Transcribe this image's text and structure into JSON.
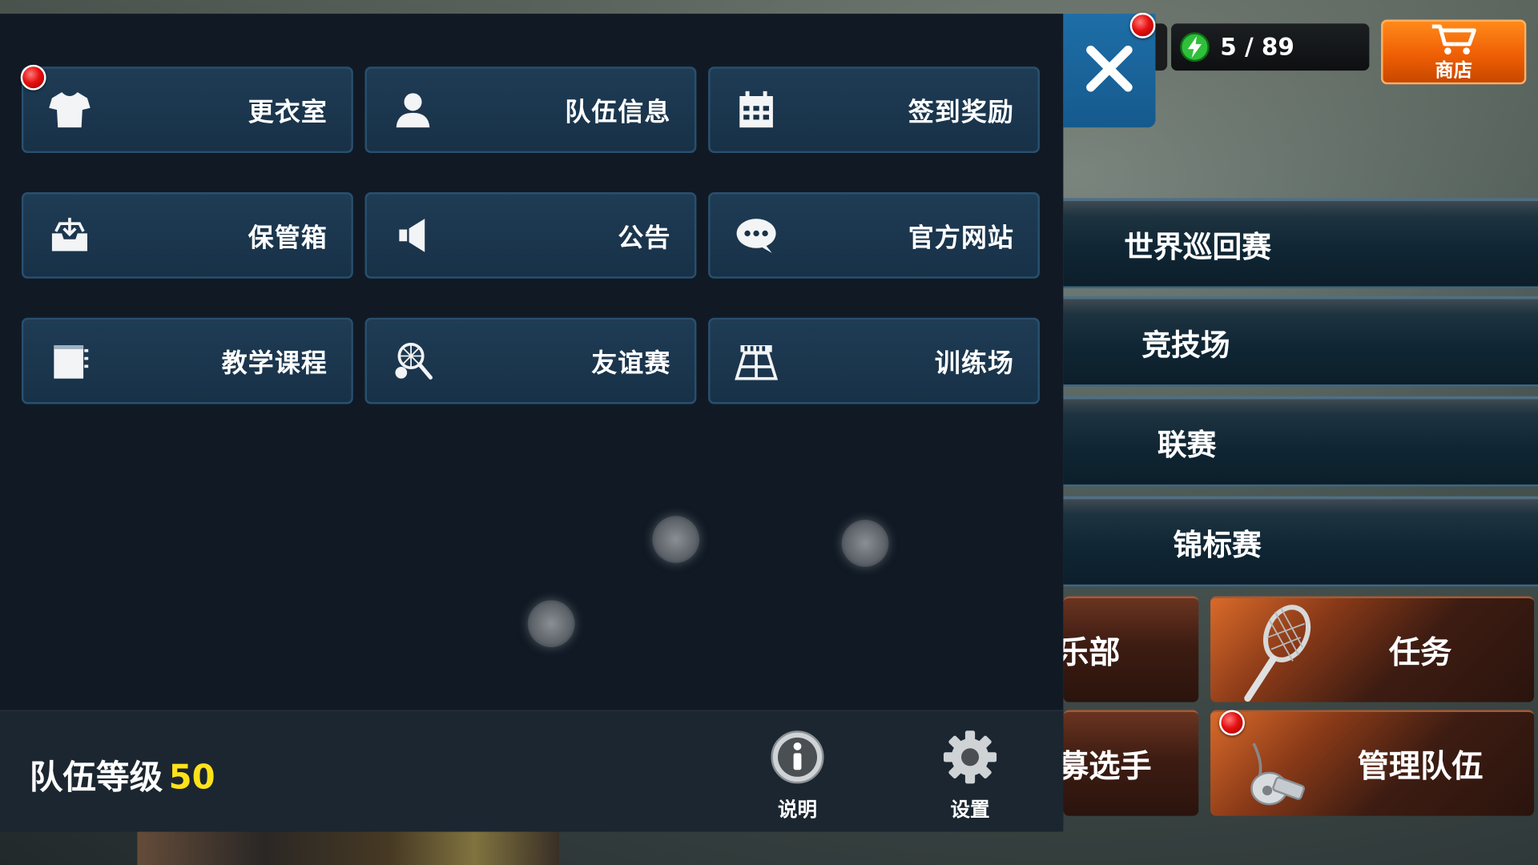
{
  "menu": {
    "items": [
      {
        "label": "更衣室",
        "icon": "shirt-icon",
        "badge": true
      },
      {
        "label": "队伍信息",
        "icon": "person-icon",
        "badge": false
      },
      {
        "label": "签到奖励",
        "icon": "calendar-icon",
        "badge": false
      },
      {
        "label": "保管箱",
        "icon": "inbox-icon",
        "badge": false
      },
      {
        "label": "公告",
        "icon": "megaphone-icon",
        "badge": false
      },
      {
        "label": "官方网站",
        "icon": "chat-bubble-icon",
        "badge": false
      },
      {
        "label": "教学课程",
        "icon": "notebook-icon",
        "badge": false
      },
      {
        "label": "友谊赛",
        "icon": "racket-ball-icon",
        "badge": false
      },
      {
        "label": "训练场",
        "icon": "court-icon",
        "badge": false
      }
    ]
  },
  "footer": {
    "team_level_label": "队伍等级",
    "team_level_value": "50",
    "help_label": "说明",
    "settings_label": "设置"
  },
  "topbar": {
    "energy": "5 / 89",
    "shop_label": "商店"
  },
  "modes": [
    {
      "label": "世界巡回赛"
    },
    {
      "label": "竞技场"
    },
    {
      "label": "联赛"
    },
    {
      "label": "锦标赛"
    }
  ],
  "tiles": {
    "club_partial": "乐部",
    "quest": "任务",
    "recruit_partial": "募选手",
    "manage_team": "管理队伍"
  },
  "colors": {
    "panel": "#111a24",
    "button": "#1a3650",
    "accent_level": "#ffe21a",
    "close": "#1e6ea8",
    "shop": "#ef5f05",
    "badge": "#e51010"
  }
}
